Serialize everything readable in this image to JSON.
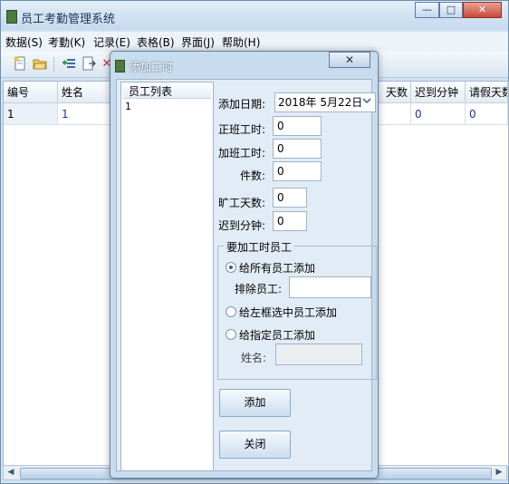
{
  "app": {
    "title": "员工考勤管理系统",
    "window_controls": {
      "minimize": "—",
      "maximize": "□",
      "close": "✕"
    }
  },
  "menu": [
    {
      "label": "数据(S)"
    },
    {
      "label": "考勤(K)"
    },
    {
      "label": "记录(E)"
    },
    {
      "label": "表格(B)"
    },
    {
      "label": "界面(J)"
    },
    {
      "label": "帮助(H)"
    }
  ],
  "toolbar": {
    "icons": [
      "new-document-icon",
      "open-folder-icon",
      "add-employee-icon",
      "export-icon",
      "delete-icon"
    ]
  },
  "grid": {
    "columns": [
      "编号",
      "姓名",
      "天数",
      "迟到分钟",
      "请假天数"
    ],
    "rows": [
      {
        "id": "1",
        "name": "1",
        "days": "",
        "late": "0",
        "leave": "0"
      }
    ]
  },
  "dialog": {
    "title": "添加工时",
    "close": "✕",
    "employee_list": {
      "header": "员工列表",
      "items": [
        "1"
      ]
    },
    "fields": {
      "add_date_label": "添加日期:",
      "add_date_value": "2018年  5月22日",
      "regular_hours_label": "正班工时:",
      "regular_hours_value": "0",
      "overtime_hours_label": "加班工时:",
      "overtime_hours_value": "0",
      "piece_count_label": "件数:",
      "piece_count_value": "0",
      "absent_days_label": "旷工天数:",
      "absent_days_value": "0",
      "late_minutes_label": "迟到分钟:",
      "late_minutes_value": "0"
    },
    "group": {
      "title": "要加工时员工",
      "option_all": "给所有员工添加",
      "exclude_label": "排除员工:",
      "exclude_value": "",
      "option_selected": "给左框选中员工添加",
      "option_specified": "给指定员工添加",
      "name_label": "姓名:",
      "name_value": "",
      "selected_option": "all"
    },
    "buttons": {
      "add": "添加",
      "close": "关闭"
    }
  }
}
